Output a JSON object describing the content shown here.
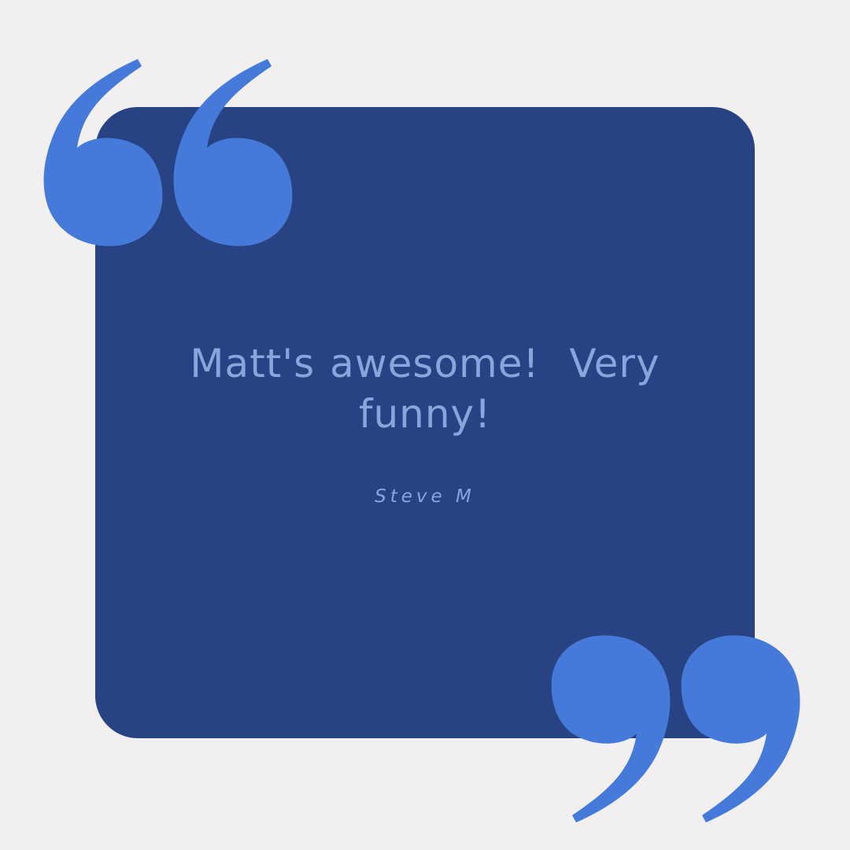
{
  "testimonial": {
    "quote": "Matt's awesome!  Very funny!",
    "author": "Steve M"
  },
  "colors": {
    "background": "#f1eff0",
    "card": "#274384",
    "quote_marks": "#4579da",
    "text": "#8aa5dc"
  },
  "icons": {
    "open_quote": "open-quote-icon",
    "close_quote": "close-quote-icon"
  }
}
